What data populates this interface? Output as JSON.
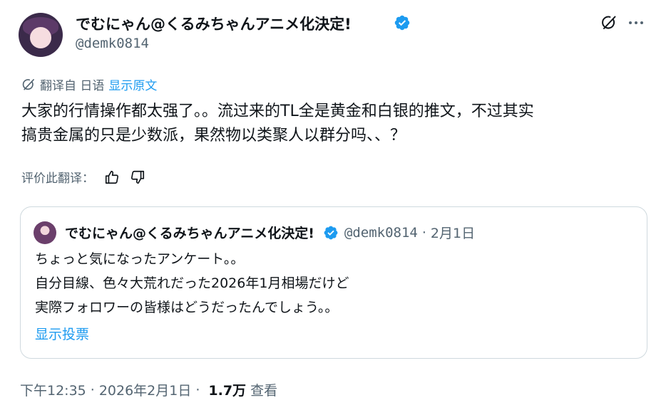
{
  "author": {
    "display_name": "でむにゃん@くるみちゃんアニメ化決定!",
    "handle": "@demk0814"
  },
  "translation": {
    "translated_from": "翻译自 日语",
    "show_original": "显示原文"
  },
  "tweet": {
    "text_line1": "大家的行情操作都太强了。。流过来的TL全是黄金和白银的推文，不过其实",
    "text_line2": "搞贵金属的只是少数派，果然物以类聚人以群分吗、、？"
  },
  "rate": {
    "label": "评价此翻译："
  },
  "quote": {
    "display_name": "でむにゃん@くるみちゃんアニメ化決定!",
    "handle": "@demk0814",
    "separator": "·",
    "date": "2月1日",
    "line1": "ちょっと気になったアンケート。。",
    "line2": "自分目線、色々大荒れだった2026年1月相場だけど",
    "line3": "実際フォロワーの皆様はどうだったんでしょう。。",
    "show_poll": "显示投票"
  },
  "meta": {
    "time": "下午12:35",
    "sep": "·",
    "date": "2026年2月1日",
    "views": "1.7万",
    "views_label": "查看"
  },
  "colors": {
    "accent": "#1d9bf0",
    "muted": "#536471",
    "text": "#0f1419",
    "border": "#cfd9de"
  },
  "icons": [
    "verified-badge-icon",
    "grok-icon",
    "more-icon",
    "translate-icon",
    "thumbs-up-icon",
    "thumbs-down-icon"
  ]
}
